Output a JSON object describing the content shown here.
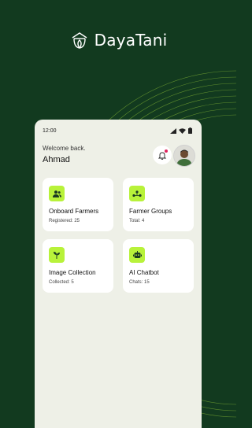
{
  "brand": {
    "name": "DayaTani"
  },
  "status_bar": {
    "time": "12:00",
    "icons": [
      "signal-icon",
      "wifi-icon",
      "battery-icon"
    ]
  },
  "greeting": {
    "welcome": "Welcome back.",
    "name": "Ahmad"
  },
  "cards": [
    {
      "title": "Onboard Farmers",
      "sub": "Registered: 25",
      "icon": "users-icon"
    },
    {
      "title": "Farmer Groups",
      "sub": "Total: 4",
      "icon": "groups-icon"
    },
    {
      "title": "Image Collection",
      "sub": "Collected: 5",
      "icon": "sprout-icon"
    },
    {
      "title": "AI Chatbot",
      "sub": "Chats: 15",
      "icon": "robot-icon"
    }
  ],
  "colors": {
    "background": "#123a1f",
    "accent": "#b8f23a",
    "panel": "#eef0e7",
    "notification": "#e0245e"
  }
}
